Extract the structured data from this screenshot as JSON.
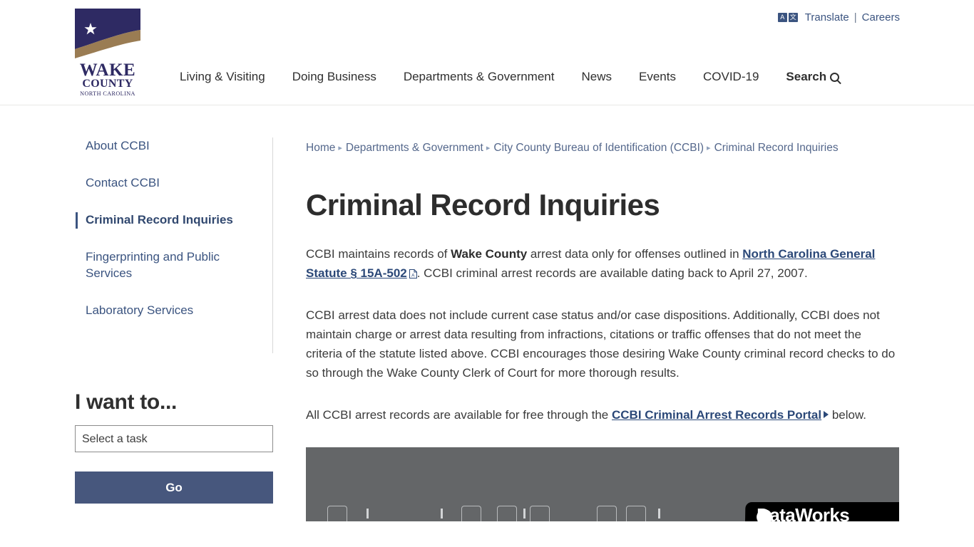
{
  "header": {
    "logo": {
      "name": "wake-county-logo",
      "line1": "WAKE",
      "line2": "COUNTY",
      "line3": "NORTH CAROLINA",
      "navy": "#2e2a63",
      "tan": "#9a7c53"
    },
    "utility": {
      "translate_label": "Translate",
      "translate_icon_a": "A",
      "translate_icon_b": "文",
      "separator": "|",
      "careers_label": "Careers"
    },
    "nav": [
      {
        "label": "Living & Visiting"
      },
      {
        "label": "Doing Business"
      },
      {
        "label": "Departments & Government"
      },
      {
        "label": "News"
      },
      {
        "label": "Events"
      },
      {
        "label": "COVID-19"
      },
      {
        "label": "Search"
      }
    ]
  },
  "sidebar": {
    "items": [
      {
        "label": "About CCBI",
        "active": false
      },
      {
        "label": "Contact CCBI",
        "active": false
      },
      {
        "label": "Criminal Record Inquiries",
        "active": true
      },
      {
        "label": "Fingerprinting and Public Services",
        "active": false
      },
      {
        "label": "Laboratory Services",
        "active": false
      }
    ],
    "i_want_to": {
      "heading": "I want to...",
      "select_value": "Select a task",
      "options": [
        "Select a task"
      ],
      "go_label": "Go"
    }
  },
  "breadcrumb": {
    "separator": "▸",
    "items": [
      {
        "label": "Home",
        "current": false
      },
      {
        "label": "Departments & Government",
        "current": false
      },
      {
        "label": "City County Bureau of Identification (CCBI)",
        "current": false
      },
      {
        "label": "Criminal Record Inquiries",
        "current": true
      }
    ]
  },
  "main": {
    "title": "Criminal Record Inquiries",
    "paragraph1": {
      "part1": "CCBI maintains records of ",
      "bold1": "Wake County",
      "part2": " arrest data only for offenses outlined in ",
      "link1": "North Carolina General Statute § 15A-502",
      "link1_icon": "pdf-icon",
      "part3": ".  CCBI criminal arrest records are available dating back to April 27, 2007."
    },
    "paragraph2": "CCBI arrest data does not include current case status and/or case dispositions.  Additionally, CCBI does not maintain charge or arrest data resulting from infractions, citations or traffic offenses that do not meet the criteria of the statute listed above. CCBI encourages those desiring Wake County criminal record checks to do so through the Wake County Clerk of Court for more thorough results.",
    "paragraph3": {
      "part1": "All CCBI arrest records are available for free through the ",
      "link1": "CCBI Criminal Arrest Records Portal",
      "link1_icon": "arrow-right-icon",
      "part2": " below."
    },
    "embed": {
      "name": "records-portal-embed",
      "background_color": "#646668",
      "logo_text": "DataWorks",
      "state": "loading-placeholder"
    }
  },
  "colors": {
    "link_blue": "#3b5480",
    "body_text": "#3b3b3b",
    "button_navy": "#47577d",
    "heading": "#2d2d2d"
  }
}
